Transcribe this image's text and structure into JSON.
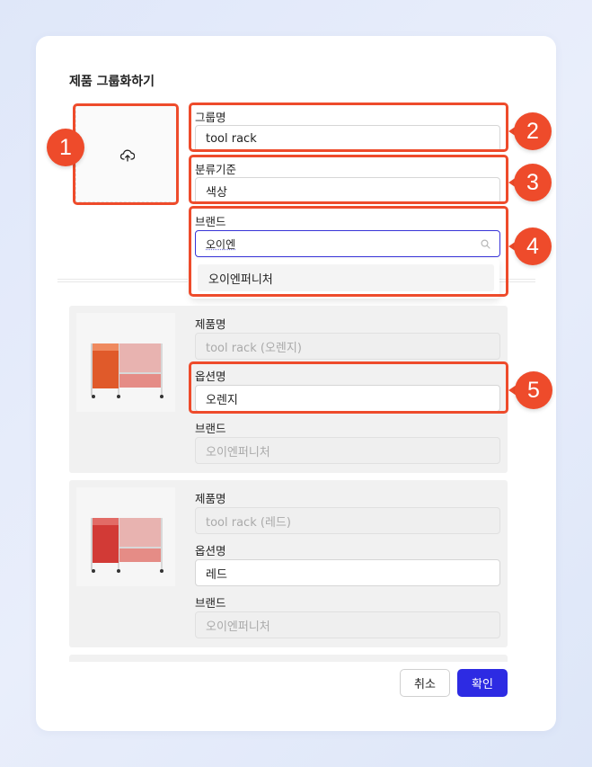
{
  "dialog": {
    "title": "제품 그룹화하기"
  },
  "group_form": {
    "group_name_label": "그룹명",
    "group_name_value": "tool rack",
    "category_label": "분류기준",
    "category_value": "색상",
    "brand_label": "브랜드",
    "brand_search_value": "오이엔",
    "brand_suggestion": "오이엔퍼니처"
  },
  "products": [
    {
      "product_name_label": "제품명",
      "product_name_value": "tool rack (오렌지)",
      "option_name_label": "옵션명",
      "option_name_value": "오렌지",
      "brand_label": "브랜드",
      "brand_value": "오이엔퍼니처",
      "color": "#e05a2a"
    },
    {
      "product_name_label": "제품명",
      "product_name_value": "tool rack (레드)",
      "option_name_label": "옵션명",
      "option_name_value": "레드",
      "brand_label": "브랜드",
      "brand_value": "오이엔퍼니처",
      "color": "#d23a36"
    }
  ],
  "buttons": {
    "cancel": "취소",
    "confirm": "확인"
  },
  "callouts": [
    "1",
    "2",
    "3",
    "4",
    "5"
  ],
  "icons": {
    "upload": "cloud-upload-icon",
    "search": "search-icon"
  },
  "colors": {
    "accent": "#2d2be3",
    "callout": "#ee4b2b"
  }
}
